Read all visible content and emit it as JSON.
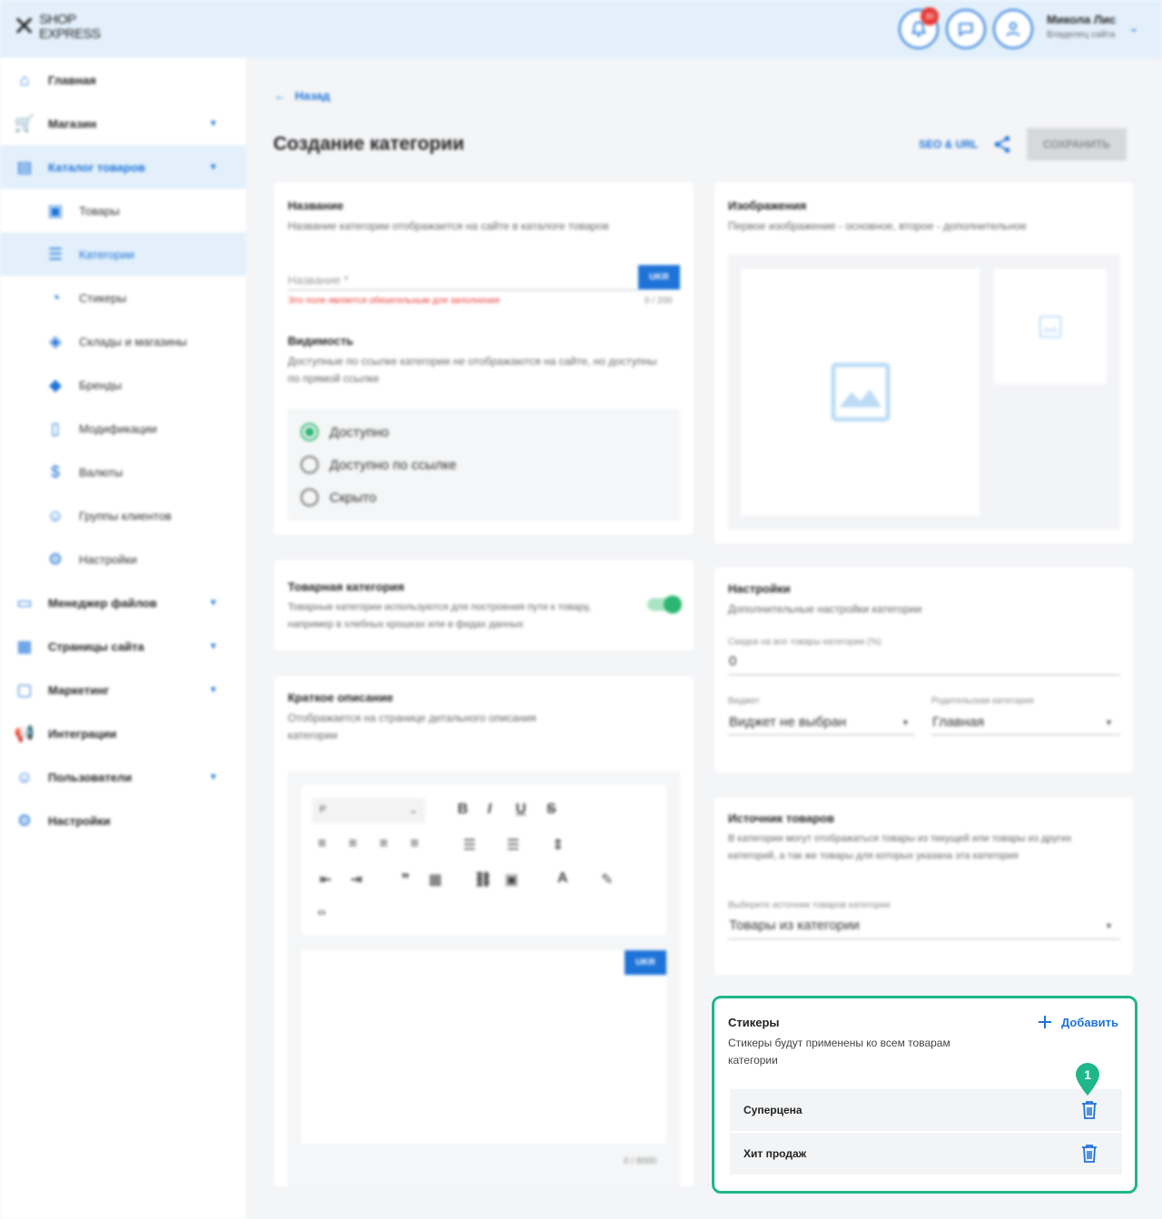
{
  "header": {
    "logo_line1": "SHOP",
    "logo_line2": "EXPRESS",
    "notifications_count": "30",
    "user_name": "Микола Лис",
    "user_role": "Владелец сайта"
  },
  "sidebar": {
    "items": [
      {
        "label": "Главная"
      },
      {
        "label": "Магазин"
      },
      {
        "label": "Каталог товаров"
      },
      {
        "label": "Товары"
      },
      {
        "label": "Категории"
      },
      {
        "label": "Стикеры"
      },
      {
        "label": "Склады и магазины"
      },
      {
        "label": "Бренды"
      },
      {
        "label": "Модификации"
      },
      {
        "label": "Валюты"
      },
      {
        "label": "Группы клиентов"
      },
      {
        "label": "Настройки"
      },
      {
        "label": "Менеджер файлов"
      },
      {
        "label": "Страницы сайта"
      },
      {
        "label": "Маркетинг"
      },
      {
        "label": "Интеграции"
      },
      {
        "label": "Пользователи"
      },
      {
        "label": "Настройки"
      }
    ]
  },
  "main": {
    "back_label": "Назад",
    "title": "Создание категории",
    "seo_label": "SEO & URL",
    "save_label": "СОХРАНИТЬ"
  },
  "name_card": {
    "title": "Название",
    "subtitle": "Название категории отображается на сайте в каталоге товаров",
    "placeholder": "Название *",
    "lang": "UKR",
    "error": "Это поле является обязательным для заполнения",
    "counter": "0 / 200",
    "visibility_title": "Видимость",
    "visibility_sub": "Доступные по ссылке категории не отображаются на сайте, но доступны по прямой ссылке",
    "options": [
      "Доступно",
      "Доступно по ссылке",
      "Скрыто"
    ]
  },
  "product_category": {
    "title": "Товарная категория",
    "subtitle": "Товарные категории используются для построения пути к товару, например в хлебных крошках или в фидах данных"
  },
  "short_desc": {
    "title": "Краткое описание",
    "subtitle": "Отображается на странице детального описания категории",
    "format": "P",
    "lang": "UKR",
    "counter": "0 / 8000"
  },
  "images": {
    "title": "Изображения",
    "subtitle": "Первое изображение - основное, второе - дополнительное"
  },
  "settings": {
    "title": "Настройки",
    "subtitle": "Дополнительные настройки категории",
    "discount_label": "Скидка на все товары категории (%)",
    "discount_value": "0",
    "widget_label": "Виджет",
    "widget_value": "Виджет не выбран",
    "parent_label": "Родительская категория",
    "parent_value": "Главная"
  },
  "source": {
    "title": "Источник товаров",
    "subtitle": "В категории могут отображаться товары из текущей или товары из других категорий, а так же товары для которых указана эта категория",
    "select_label": "Выберите источник товаров категории",
    "select_value": "Товары из категории"
  },
  "stickers": {
    "title": "Стикеры",
    "subtitle": "Стикеры будут применены ко всем товарам категории",
    "add_label": "Добавить",
    "pin_number": "1",
    "items": [
      {
        "name": "Суперцена"
      },
      {
        "name": "Хит продаж"
      }
    ]
  },
  "colors": {
    "accent": "#1e73d8",
    "highlight": "#1fb78a",
    "header_bg": "#e3f0fb",
    "error": "#e53935"
  }
}
